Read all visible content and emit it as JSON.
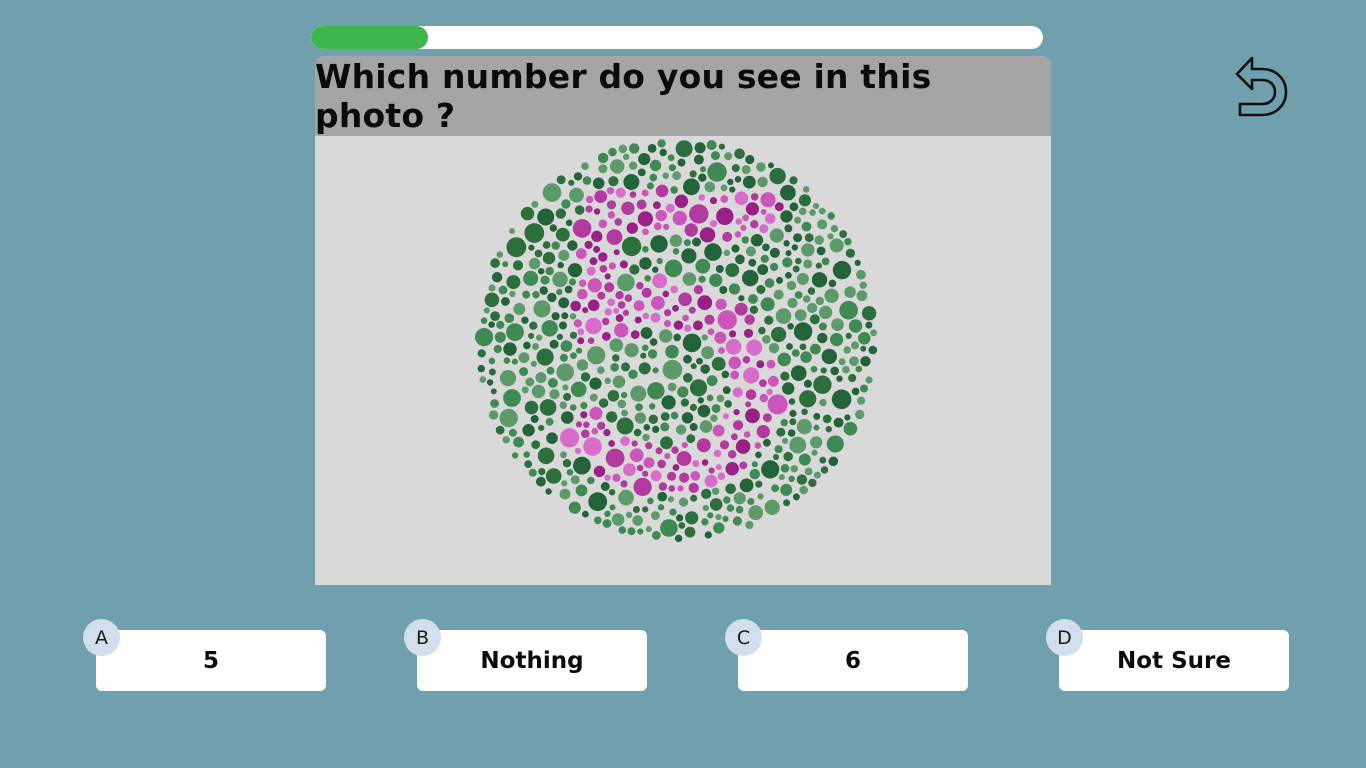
{
  "progress": {
    "value": 0.16,
    "fill_color": "#3db64e"
  },
  "question": {
    "title": "Which number do you see in this photo ?"
  },
  "plate": {
    "icon": "ishihara-color-plate",
    "background_dot_colors": [
      "#2c6e3c",
      "#3f8a52",
      "#5c9a6a",
      "#23633a"
    ],
    "figure_dot_colors": [
      "#b23a9f",
      "#cc55bb",
      "#9a1f86",
      "#d86ccc"
    ]
  },
  "back_button": {
    "icon": "undo-arrow-icon"
  },
  "answers": [
    {
      "letter": "A",
      "text": "5"
    },
    {
      "letter": "B",
      "text": "Nothing"
    },
    {
      "letter": "C",
      "text": "6"
    },
    {
      "letter": "D",
      "text": "Not Sure"
    }
  ]
}
